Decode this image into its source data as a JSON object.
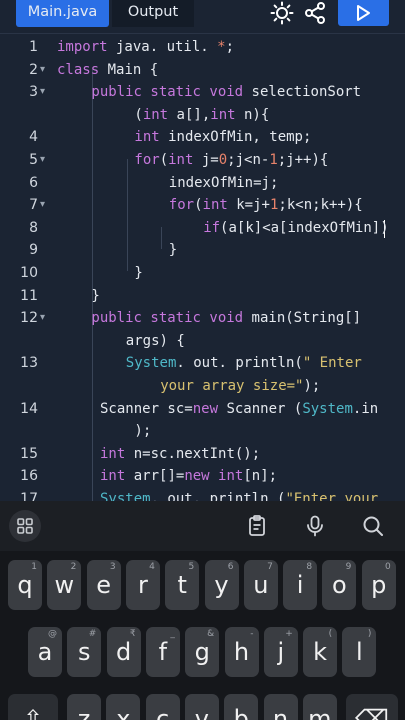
{
  "toolbar": {
    "tabs": [
      {
        "label": "Main.java",
        "active": true
      },
      {
        "label": "Output",
        "active": false
      }
    ],
    "icons": [
      "brightness-icon",
      "share-icon",
      "run-icon"
    ],
    "accent": "#2a6fe6"
  },
  "editor": {
    "rows": [
      {
        "ln": "1",
        "fold": false,
        "ind": 0,
        "tokens": [
          {
            "t": "import",
            "c": "kw"
          },
          {
            "t": " java. util. ",
            "c": "id"
          },
          {
            "t": "*",
            "c": "num"
          },
          {
            "t": ";",
            "c": "id"
          }
        ]
      },
      {
        "ln": "2",
        "fold": true,
        "ind": 0,
        "tokens": [
          {
            "t": "class",
            "c": "kw"
          },
          {
            "t": " Main {",
            "c": "id"
          }
        ]
      },
      {
        "ln": "3",
        "fold": true,
        "ind": 4,
        "tokens": [
          {
            "t": "public static void",
            "c": "kw"
          },
          {
            "t": " selectionSort",
            "c": "id"
          }
        ]
      },
      {
        "ln": "",
        "fold": false,
        "ind": 9,
        "tokens": [
          {
            "t": "(",
            "c": "id"
          },
          {
            "t": "int",
            "c": "kw"
          },
          {
            "t": " a[],",
            "c": "id"
          },
          {
            "t": "int",
            "c": "kw"
          },
          {
            "t": " n){",
            "c": "id"
          }
        ]
      },
      {
        "ln": "4",
        "fold": false,
        "ind": 9,
        "tokens": [
          {
            "t": "int",
            "c": "kw"
          },
          {
            "t": " indexOfMin, temp;",
            "c": "id"
          }
        ]
      },
      {
        "ln": "5",
        "fold": true,
        "ind": 9,
        "tokens": [
          {
            "t": "for",
            "c": "kw"
          },
          {
            "t": "(",
            "c": "id"
          },
          {
            "t": "int",
            "c": "kw"
          },
          {
            "t": " j=",
            "c": "id"
          },
          {
            "t": "0",
            "c": "num"
          },
          {
            "t": ";j<n-",
            "c": "id"
          },
          {
            "t": "1",
            "c": "num"
          },
          {
            "t": ";j++){",
            "c": "id"
          }
        ]
      },
      {
        "ln": "6",
        "fold": false,
        "ind": 13,
        "tokens": [
          {
            "t": "indexOfMin=j;",
            "c": "id"
          }
        ]
      },
      {
        "ln": "7",
        "fold": true,
        "ind": 13,
        "tokens": [
          {
            "t": "for",
            "c": "kw"
          },
          {
            "t": "(",
            "c": "id"
          },
          {
            "t": "int",
            "c": "kw"
          },
          {
            "t": " k=j+",
            "c": "id"
          },
          {
            "t": "1",
            "c": "num"
          },
          {
            "t": ";k<n;k++){",
            "c": "id"
          }
        ]
      },
      {
        "ln": "8",
        "fold": false,
        "ind": 17,
        "tokens": [
          {
            "t": "if",
            "c": "kw"
          },
          {
            "t": "(a[k]<a[indexOfMin])",
            "c": "id"
          }
        ]
      },
      {
        "ln": "9",
        "fold": false,
        "ind": 13,
        "tokens": [
          {
            "t": "}",
            "c": "id"
          }
        ]
      },
      {
        "ln": "10",
        "fold": false,
        "ind": 9,
        "tokens": [
          {
            "t": "}",
            "c": "id"
          }
        ]
      },
      {
        "ln": "11",
        "fold": false,
        "ind": 4,
        "tokens": [
          {
            "t": "}",
            "c": "id"
          }
        ]
      },
      {
        "ln": "12",
        "fold": true,
        "ind": 4,
        "tokens": [
          {
            "t": "public static void",
            "c": "kw"
          },
          {
            "t": " main(String[]",
            "c": "id"
          }
        ]
      },
      {
        "ln": "",
        "fold": false,
        "ind": 8,
        "tokens": [
          {
            "t": "args) {",
            "c": "id"
          }
        ]
      },
      {
        "ln": "13",
        "fold": false,
        "ind": 8,
        "tokens": [
          {
            "t": "System",
            "c": "cls"
          },
          {
            "t": ". out. println(",
            "c": "id"
          },
          {
            "t": "\" Enter",
            "c": "str"
          }
        ]
      },
      {
        "ln": "",
        "fold": false,
        "ind": 12,
        "tokens": [
          {
            "t": "your array size=\"",
            "c": "str"
          },
          {
            "t": ");",
            "c": "id"
          }
        ]
      },
      {
        "ln": "14",
        "fold": false,
        "ind": 5,
        "tokens": [
          {
            "t": "Scanner sc=",
            "c": "id"
          },
          {
            "t": "new",
            "c": "kw"
          },
          {
            "t": " Scanner (",
            "c": "id"
          },
          {
            "t": "System",
            "c": "cls"
          },
          {
            "t": ".in",
            "c": "id"
          }
        ]
      },
      {
        "ln": "",
        "fold": false,
        "ind": 9,
        "tokens": [
          {
            "t": ");",
            "c": "id"
          }
        ]
      },
      {
        "ln": "15",
        "fold": false,
        "ind": 5,
        "tokens": [
          {
            "t": "int",
            "c": "kw"
          },
          {
            "t": " n=sc.nextInt();",
            "c": "id"
          }
        ]
      },
      {
        "ln": "16",
        "fold": false,
        "ind": 5,
        "tokens": [
          {
            "t": "int",
            "c": "kw"
          },
          {
            "t": " arr[]=",
            "c": "id"
          },
          {
            "t": "new",
            "c": "kw"
          },
          {
            "t": " ",
            "c": "id"
          },
          {
            "t": "int",
            "c": "kw"
          },
          {
            "t": "[n];",
            "c": "id"
          }
        ]
      },
      {
        "ln": "17",
        "fold": false,
        "ind": 5,
        "tokens": [
          {
            "t": "System",
            "c": "cls"
          },
          {
            "t": ". out. println (",
            "c": "id"
          },
          {
            "t": "\"Enter your",
            "c": "str"
          }
        ]
      }
    ]
  },
  "keyboard": {
    "tools": [
      "apps-grid-icon",
      "clipboard-icon",
      "microphone-icon",
      "search-icon"
    ],
    "rows": [
      {
        "keys": [
          {
            "ch": "q",
            "hint": "1"
          },
          {
            "ch": "w",
            "hint": "2"
          },
          {
            "ch": "e",
            "hint": "3"
          },
          {
            "ch": "r",
            "hint": "4"
          },
          {
            "ch": "t",
            "hint": "5"
          },
          {
            "ch": "y",
            "hint": "6"
          },
          {
            "ch": "u",
            "hint": "7"
          },
          {
            "ch": "i",
            "hint": "8"
          },
          {
            "ch": "o",
            "hint": "9"
          },
          {
            "ch": "p",
            "hint": "0"
          }
        ]
      },
      {
        "keys": [
          {
            "ch": "a",
            "hint": "@"
          },
          {
            "ch": "s",
            "hint": "#"
          },
          {
            "ch": "d",
            "hint": "₹"
          },
          {
            "ch": "f",
            "hint": "_"
          },
          {
            "ch": "g",
            "hint": "&"
          },
          {
            "ch": "h",
            "hint": "-"
          },
          {
            "ch": "j",
            "hint": "+"
          },
          {
            "ch": "k",
            "hint": "("
          },
          {
            "ch": "l",
            "hint": ")"
          }
        ]
      },
      {
        "keys": [
          {
            "ch": "⇧",
            "hint": ""
          },
          {
            "ch": "z",
            "hint": ""
          },
          {
            "ch": "x",
            "hint": ""
          },
          {
            "ch": "c",
            "hint": ""
          },
          {
            "ch": "v",
            "hint": ""
          },
          {
            "ch": "b",
            "hint": ""
          },
          {
            "ch": "n",
            "hint": ""
          },
          {
            "ch": "m",
            "hint": ""
          },
          {
            "ch": "⌫",
            "hint": ""
          }
        ]
      }
    ]
  }
}
